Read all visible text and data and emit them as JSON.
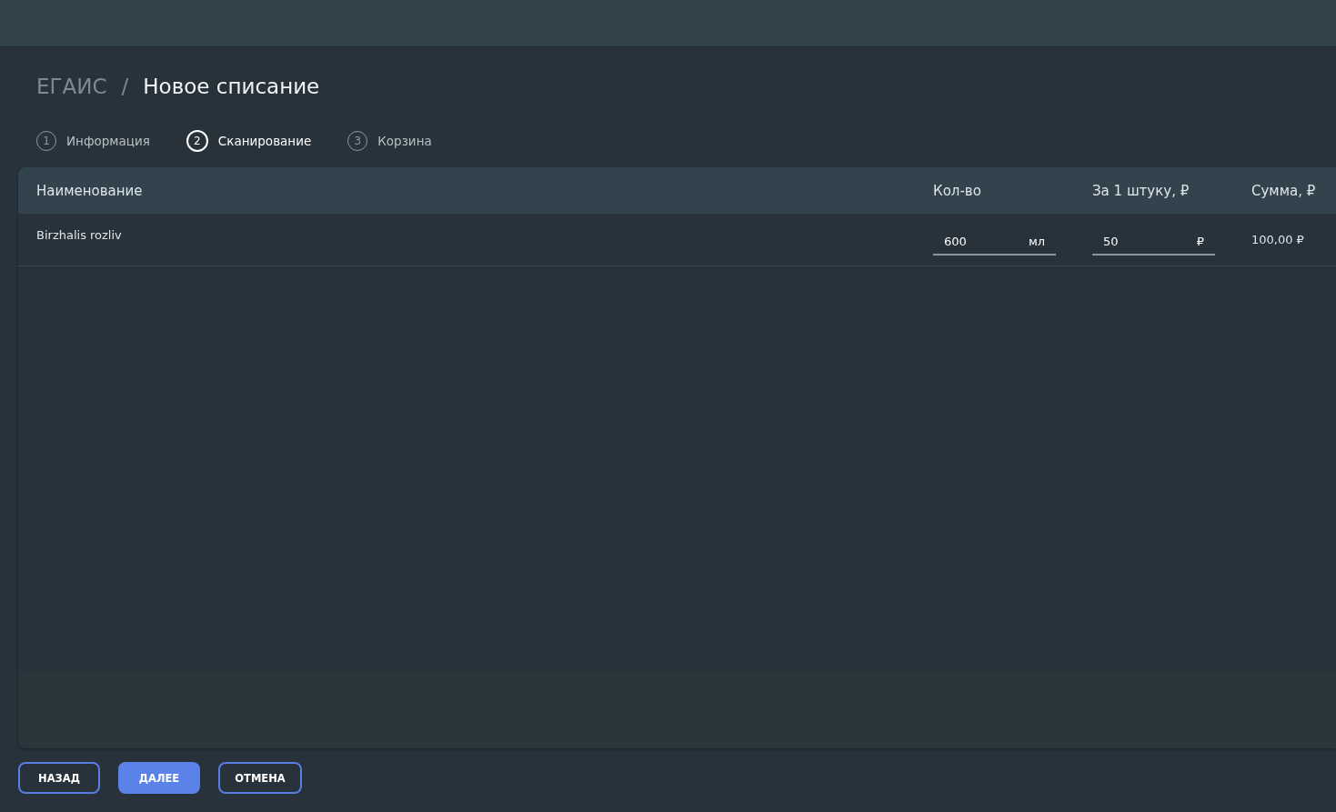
{
  "breadcrumb": {
    "parent": "ЕГАИС",
    "separator": "/",
    "current": "Новое списание"
  },
  "steps": [
    {
      "number": "1",
      "label": "Информация",
      "selected": false
    },
    {
      "number": "2",
      "label": "Сканирование",
      "selected": true
    },
    {
      "number": "3",
      "label": "Корзина",
      "selected": false
    }
  ],
  "table": {
    "columns": [
      "Наименование",
      "Кол-во",
      "За 1 штуку, ₽",
      "Сумма, ₽"
    ],
    "rows": [
      {
        "name": "Birzhalis rozliv",
        "quantity": {
          "value": "600",
          "unit": "мл"
        },
        "price": {
          "value": "50",
          "unit": "₽"
        },
        "sum": "100,00 ₽"
      }
    ]
  },
  "buttons": [
    {
      "label": "НАЗАД",
      "kind": "outlined"
    },
    {
      "label": "ДАЛЕЕ",
      "kind": "primary"
    },
    {
      "label": "ОТМЕНА",
      "kind": "outlined"
    }
  ]
}
